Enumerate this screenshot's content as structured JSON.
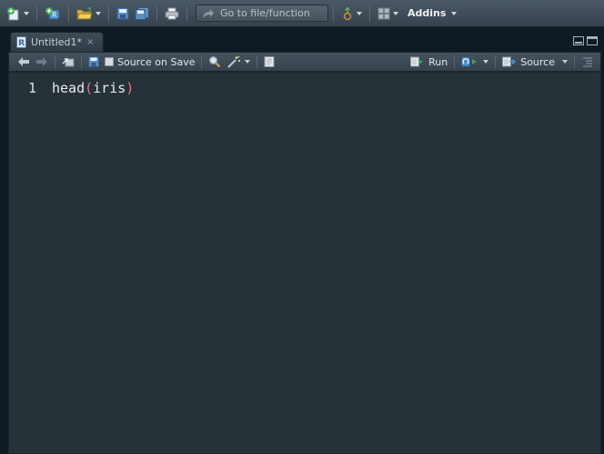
{
  "toolbar": {
    "goto_placeholder": "Go to file/function",
    "addins_label": "Addins"
  },
  "editor": {
    "tab_name": "Untitled1*",
    "tab_close": "×",
    "source_on_save_label": "Source on Save",
    "source_on_save_checked": false,
    "run_label": "Run",
    "source_label": "Source",
    "lines": [
      {
        "number": "1",
        "fn": "head",
        "open": "(",
        "arg": "iris",
        "close": ")"
      }
    ]
  },
  "colors": {
    "editor_bg": "#263238",
    "paren": "#f07178",
    "toolbar_top": "#4b5966"
  }
}
